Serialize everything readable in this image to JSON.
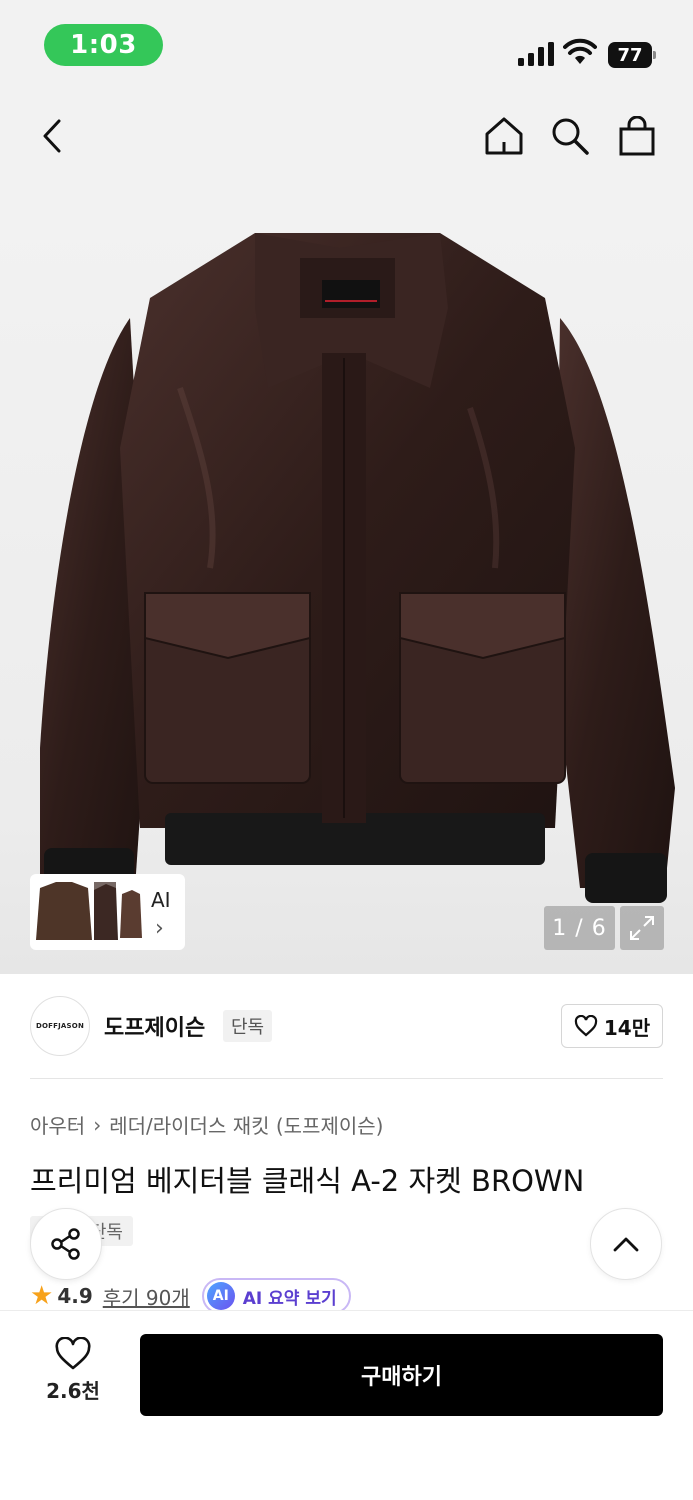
{
  "status_bar": {
    "time": "1:03",
    "battery": "77"
  },
  "gallery": {
    "page_indicator": "1 / 6",
    "ai_label": "AI"
  },
  "brand": {
    "logo_text": "DOFFJASON",
    "name": "도프제이슨",
    "tag": "단독",
    "likes": "14만"
  },
  "breadcrumb": {
    "category": "아우터",
    "subcategory": "레더/라이더스 재킷 (도프제이슨)"
  },
  "product": {
    "title": "프리미엄 베지터블 클래식 A-2 자켓 BROWN",
    "tag": "단독",
    "rating": "4.9",
    "review_link": "후기 90개",
    "ai_badge": "AI",
    "ai_summary": "AI 요약 보기"
  },
  "bottom_bar": {
    "wish_count": "2.6천",
    "buy_label": "구매하기"
  },
  "colors": {
    "status_green": "#34c759",
    "buy_button": "#000000",
    "star": "#f7a21b",
    "ai_accent": "#5b3fd0"
  },
  "icons": [
    "back-icon",
    "home-icon",
    "search-icon",
    "bag-icon",
    "expand-icon",
    "heart-icon",
    "share-icon",
    "chevron-up-icon",
    "star-icon"
  ]
}
